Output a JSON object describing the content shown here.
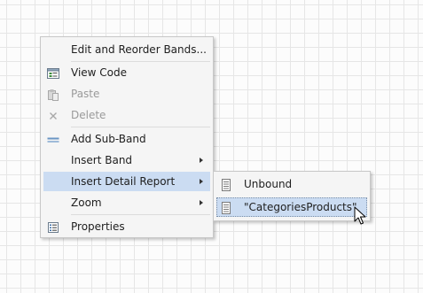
{
  "context_menu": {
    "items": [
      {
        "label": "Edit and Reorder Bands...",
        "icon": "none",
        "enabled": true
      },
      {
        "label": "View Code",
        "icon": "view-code-icon",
        "enabled": true
      },
      {
        "label": "Paste",
        "icon": "paste-icon",
        "enabled": false
      },
      {
        "label": "Delete",
        "icon": "delete-icon",
        "enabled": false
      },
      {
        "label": "Add Sub-Band",
        "icon": "add-sub-band-icon",
        "enabled": true
      },
      {
        "label": "Insert Band",
        "icon": "none",
        "enabled": true,
        "has_submenu": true
      },
      {
        "label": "Insert Detail Report",
        "icon": "none",
        "enabled": true,
        "has_submenu": true,
        "selected": true
      },
      {
        "label": "Zoom",
        "icon": "none",
        "enabled": true,
        "has_submenu": true
      },
      {
        "label": "Properties",
        "icon": "properties-icon",
        "enabled": true
      }
    ]
  },
  "submenu": {
    "items": [
      {
        "label": "Unbound",
        "icon": "report-page-icon"
      },
      {
        "label": "\"CategoriesProducts\"",
        "icon": "report-page-icon",
        "hovered": true
      }
    ]
  },
  "colors": {
    "selection_bg": "#cbdcf2",
    "menu_bg": "#f5f5f5",
    "disabled_text": "#9a9a9a",
    "grid_line": "#e6e6e6"
  }
}
